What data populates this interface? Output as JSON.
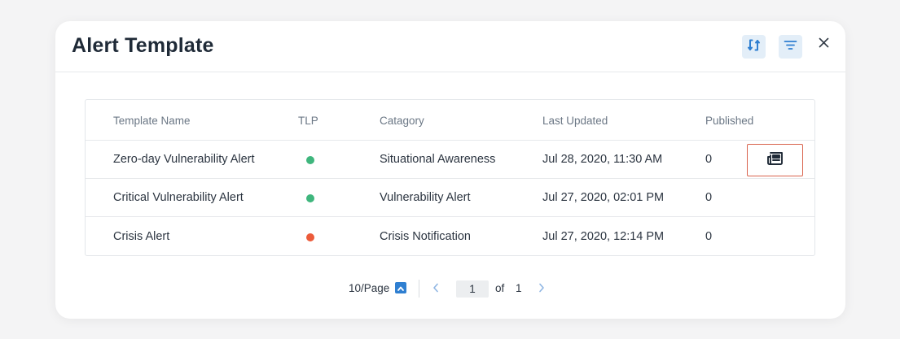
{
  "dialog": {
    "title": "Alert Template",
    "refresh_icon": "refresh-icon",
    "filter_icon": "filter-icon",
    "close_icon": "close-icon"
  },
  "table": {
    "columns": {
      "name": "Template Name",
      "tlp": "TLP",
      "category": "Catagory",
      "updated": "Last Updated",
      "published": "Published"
    },
    "rows": [
      {
        "name": "Zero-day Vulnerability Alert",
        "tlp_color": "#3fb67d",
        "category": "Situational Awareness",
        "updated": "Jul 28, 2020, 11:30 AM",
        "published": "0",
        "action_icon": "newspaper-icon"
      },
      {
        "name": "Critical Vulnerability Alert",
        "tlp_color": "#3fb67d",
        "category": "Vulnerability Alert",
        "updated": "Jul 27, 2020, 02:01 PM",
        "published": "0"
      },
      {
        "name": "Crisis Alert",
        "tlp_color": "#ec5b3a",
        "category": "Crisis Notification",
        "updated": "Jul 27, 2020, 12:14 PM",
        "published": "0"
      }
    ]
  },
  "pagination": {
    "page_size": "10/Page",
    "current_page": "1",
    "of_label": "of",
    "total_pages": "1"
  },
  "colors": {
    "accent": "#2f7fd1",
    "highlight_border": "#d9634d"
  }
}
